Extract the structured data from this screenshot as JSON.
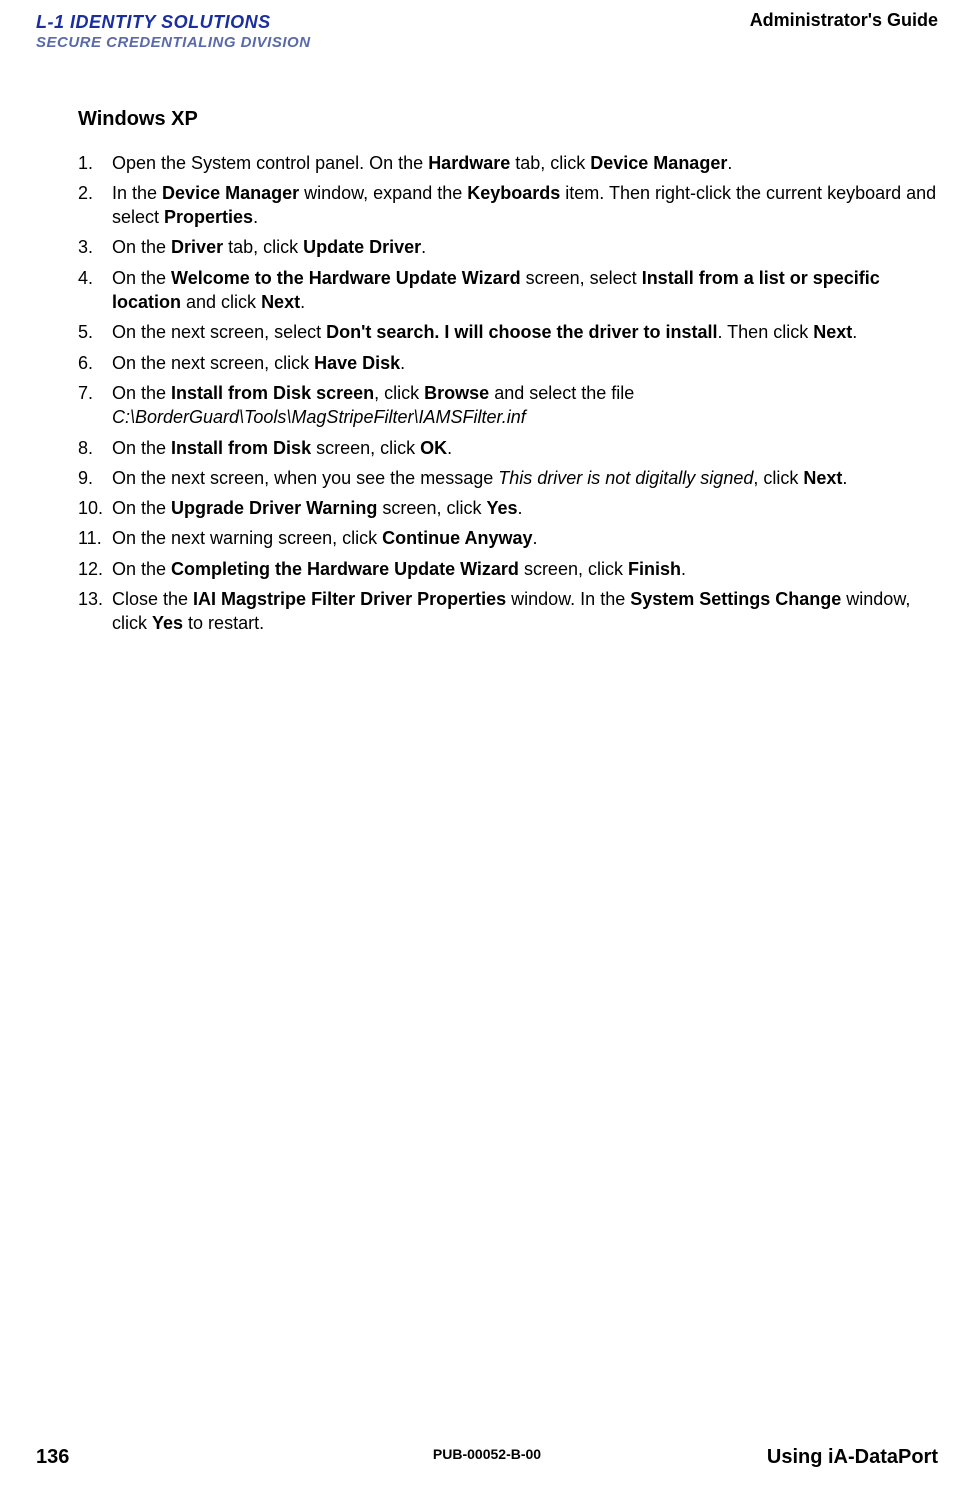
{
  "header": {
    "logo_line1": "L-1 IDENTITY SOLUTIONS",
    "logo_line2": "SECURE CREDENTIALING DIVISION",
    "doc_title": "Administrator's Guide"
  },
  "section": {
    "heading": "Windows XP"
  },
  "steps": {
    "s1": {
      "t0": "Open the System control panel. On the ",
      "b0": "Hardware",
      "t1": " tab, click ",
      "b1": "Device Manager",
      "t2": "."
    },
    "s2": {
      "t0": "In the ",
      "b0": "Device Manager",
      "t1": " window, expand the ",
      "b1": "Keyboards",
      "t2": " item. Then right-click the current keyboard and select ",
      "b2": "Properties",
      "t3": "."
    },
    "s3": {
      "t0": "On the ",
      "b0": "Driver",
      "t1": " tab, click ",
      "b1": "Update Driver",
      "t2": "."
    },
    "s4": {
      "t0": "On the ",
      "b0": "Welcome to the Hardware Update Wizard",
      "t1": " screen, select ",
      "b1": "Install from a list or specific location",
      "t2": " and click ",
      "b2": "Next",
      "t3": "."
    },
    "s5": {
      "t0": "On the next screen, select ",
      "b0": "Don't search. I will choose the driver to install",
      "t1": ". Then click ",
      "b1": "Next",
      "t2": "."
    },
    "s6": {
      "t0": "On the next screen, click ",
      "b0": "Have Disk",
      "t1": "."
    },
    "s7": {
      "t0": "On the ",
      "b0": "Install from Disk screen",
      "t1": ", click ",
      "b1": "Browse",
      "t2": " and select the file ",
      "i0": "C:\\BorderGuard\\Tools\\MagStripeFilter\\IAMSFilter.inf"
    },
    "s8": {
      "t0": "On the ",
      "b0": "Install from Disk",
      "t1": " screen, click ",
      "b1": "OK",
      "t2": "."
    },
    "s9": {
      "t0": "On the next screen, when you see the message ",
      "i0": "This driver is not digitally signed",
      "t1": ", click ",
      "b0": "Next",
      "t2": "."
    },
    "s10": {
      "t0": "On the ",
      "b0": "Upgrade Driver Warning",
      "t1": " screen, click ",
      "b1": "Yes",
      "t2": "."
    },
    "s11": {
      "t0": "On the next warning screen, click ",
      "b0": "Continue Anyway",
      "t1": "."
    },
    "s12": {
      "t0": "On the ",
      "b0": "Completing the Hardware Update Wizard",
      "t1": " screen, click ",
      "b1": "Finish",
      "t2": "."
    },
    "s13": {
      "t0": "Close the ",
      "b0": "IAI Magstripe Filter Driver Properties",
      "t1": " window. In the ",
      "b1": "System Settings Change",
      "t2": " window, click ",
      "b2": "Yes",
      "t3": " to restart."
    }
  },
  "footer": {
    "page_number": "136",
    "pub_id": "PUB-00052-B-00",
    "section_name": "Using iA-DataPort"
  }
}
